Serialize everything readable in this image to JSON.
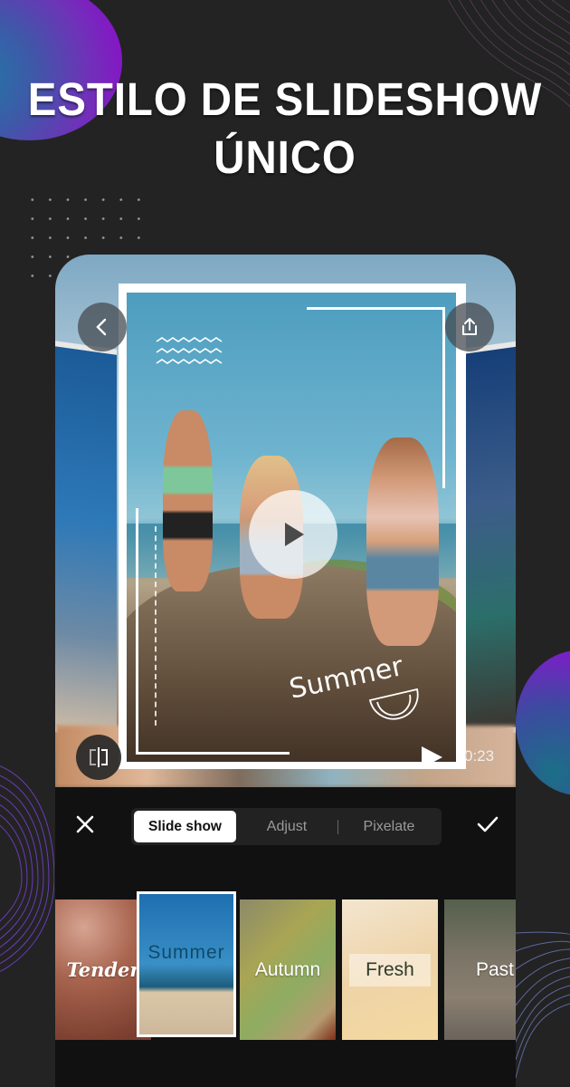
{
  "headline": {
    "line1": "ESTILO DE SLIDESHOW",
    "line2": "ÚNICO"
  },
  "preview": {
    "back_icon": "chevron-left-icon",
    "share_icon": "share-upload-icon",
    "compare_icon": "compare-split-icon",
    "play_icon": "play-icon",
    "sticker_text": "Summer",
    "timestamp": "0:23"
  },
  "toolbar": {
    "close_icon": "close-icon",
    "confirm_icon": "check-icon",
    "tabs": [
      {
        "label": "Slide show",
        "active": true
      },
      {
        "label": "Adjust",
        "active": false
      },
      {
        "label": "Pixelate",
        "active": false
      }
    ]
  },
  "styles": [
    {
      "label": "Tender",
      "selected": false
    },
    {
      "label": "Summer",
      "selected": true
    },
    {
      "label": "Autumn",
      "selected": false
    },
    {
      "label": "Fresh",
      "selected": false
    },
    {
      "label": "Past",
      "selected": false
    }
  ],
  "colors": {
    "page_background": "#232323",
    "panel_background": "#111111",
    "accent_purple": "#8a10c8",
    "active_tab": "#ffffff"
  }
}
